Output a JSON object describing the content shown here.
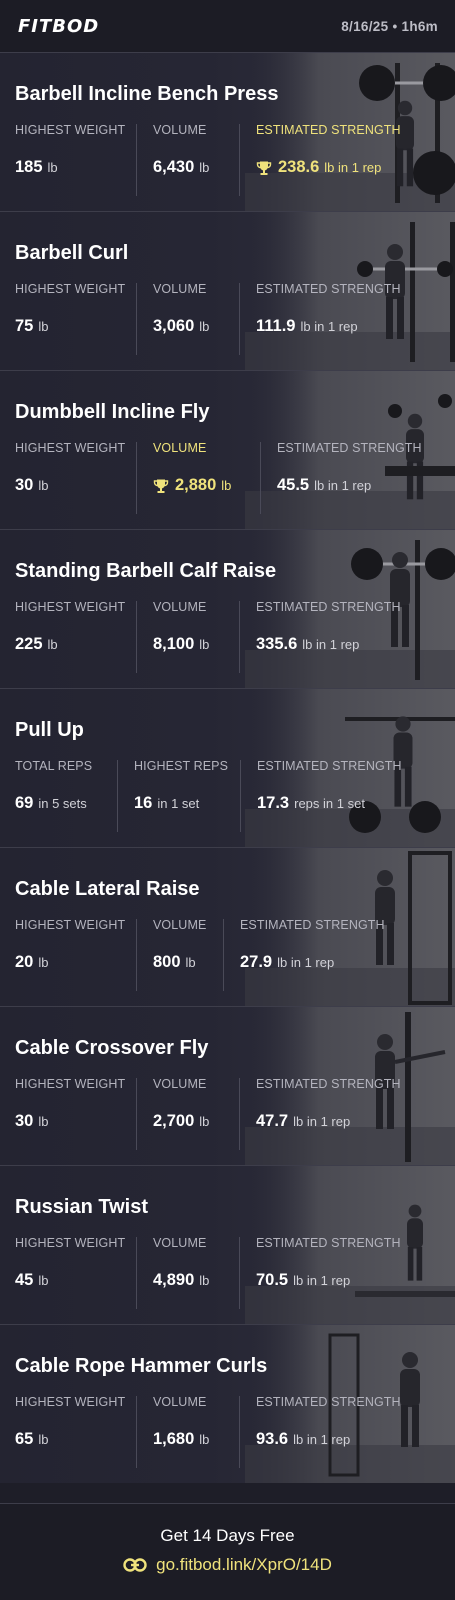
{
  "header": {
    "logo": "FITBOD",
    "meta": "8/16/25 • 1h6m"
  },
  "colors": {
    "accent": "#efe27c",
    "background": "#1e1e28",
    "label": "#b4b4be"
  },
  "exercises": [
    {
      "title": "Barbell Incline Bench Press",
      "stats": [
        {
          "label": "HIGHEST WEIGHT",
          "value": "185",
          "unit": "lb"
        },
        {
          "label": "VOLUME",
          "value": "6,430",
          "unit": "lb"
        },
        {
          "label": "ESTIMATED STRENGTH",
          "value": "238.6",
          "unit": "lb in 1 rep",
          "highlight": true,
          "icon": "trophy-icon"
        }
      ]
    },
    {
      "title": "Barbell Curl",
      "stats": [
        {
          "label": "HIGHEST WEIGHT",
          "value": "75",
          "unit": "lb"
        },
        {
          "label": "VOLUME",
          "value": "3,060",
          "unit": "lb"
        },
        {
          "label": "ESTIMATED STRENGTH",
          "value": "111.9",
          "unit": "lb in 1 rep"
        }
      ]
    },
    {
      "title": "Dumbbell Incline Fly",
      "stats": [
        {
          "label": "HIGHEST WEIGHT",
          "value": "30",
          "unit": "lb"
        },
        {
          "label": "VOLUME",
          "value": "2,880",
          "unit": "lb",
          "highlight": true,
          "icon": "trophy-icon"
        },
        {
          "label": "ESTIMATED STRENGTH",
          "value": "45.5",
          "unit": "lb in 1 rep"
        }
      ]
    },
    {
      "title": "Standing Barbell Calf Raise",
      "stats": [
        {
          "label": "HIGHEST WEIGHT",
          "value": "225",
          "unit": "lb"
        },
        {
          "label": "VOLUME",
          "value": "8,100",
          "unit": "lb"
        },
        {
          "label": "ESTIMATED STRENGTH",
          "value": "335.6",
          "unit": "lb in 1 rep"
        }
      ]
    },
    {
      "title": "Pull Up",
      "stats": [
        {
          "label": "TOTAL REPS",
          "value": "69",
          "unit": "in 5 sets"
        },
        {
          "label": "HIGHEST REPS",
          "value": "16",
          "unit": "in 1 set"
        },
        {
          "label": "ESTIMATED STRENGTH",
          "value": "17.3",
          "unit": "reps in 1 set"
        }
      ]
    },
    {
      "title": "Cable Lateral Raise",
      "stats": [
        {
          "label": "HIGHEST WEIGHT",
          "value": "20",
          "unit": "lb"
        },
        {
          "label": "VOLUME",
          "value": "800",
          "unit": "lb"
        },
        {
          "label": "ESTIMATED STRENGTH",
          "value": "27.9",
          "unit": "lb in 1 rep"
        }
      ]
    },
    {
      "title": "Cable Crossover Fly",
      "stats": [
        {
          "label": "HIGHEST WEIGHT",
          "value": "30",
          "unit": "lb"
        },
        {
          "label": "VOLUME",
          "value": "2,700",
          "unit": "lb"
        },
        {
          "label": "ESTIMATED STRENGTH",
          "value": "47.7",
          "unit": "lb in 1 rep"
        }
      ]
    },
    {
      "title": "Russian Twist",
      "stats": [
        {
          "label": "HIGHEST WEIGHT",
          "value": "45",
          "unit": "lb"
        },
        {
          "label": "VOLUME",
          "value": "4,890",
          "unit": "lb"
        },
        {
          "label": "ESTIMATED STRENGTH",
          "value": "70.5",
          "unit": "lb in 1 rep"
        }
      ]
    },
    {
      "title": "Cable Rope Hammer Curls",
      "stats": [
        {
          "label": "HIGHEST WEIGHT",
          "value": "65",
          "unit": "lb"
        },
        {
          "label": "VOLUME",
          "value": "1,680",
          "unit": "lb"
        },
        {
          "label": "ESTIMATED STRENGTH",
          "value": "93.6",
          "unit": "lb in 1 rep"
        }
      ]
    }
  ],
  "footer": {
    "promo": "Get 14 Days Free",
    "link": "go.fitbod.link/XprO/14D",
    "link_icon": "link-icon"
  }
}
